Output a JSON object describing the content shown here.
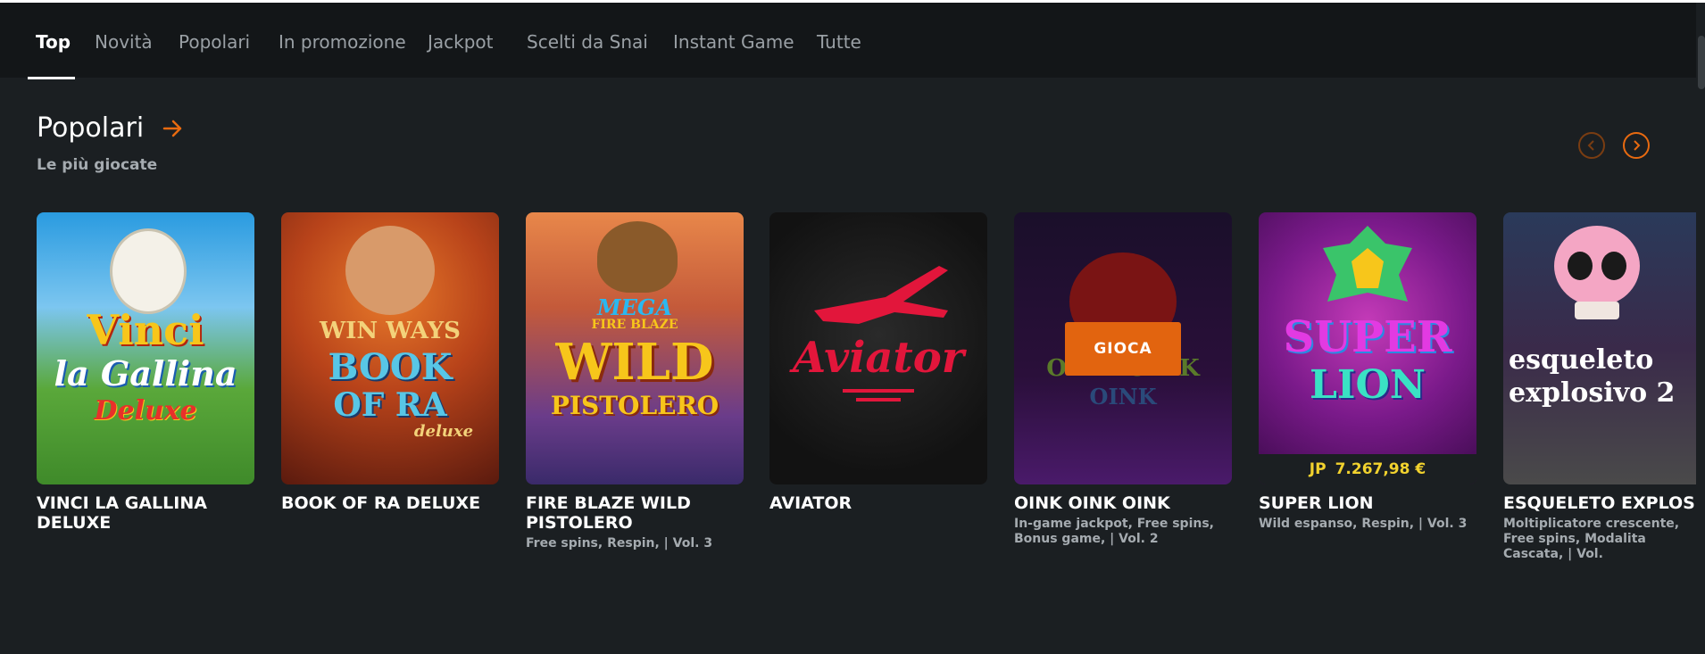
{
  "tabs": [
    {
      "label": "Top",
      "active": true
    },
    {
      "label": "Novità",
      "active": false
    },
    {
      "label": "Popolari",
      "active": false
    },
    {
      "label": "In promozione",
      "active": false
    },
    {
      "label": "Jackpot",
      "active": false
    },
    {
      "label": "Scelti da Snai",
      "active": false
    },
    {
      "label": "Instant Game",
      "active": false
    },
    {
      "label": "Tutte",
      "active": false
    }
  ],
  "section": {
    "title": "Popolari",
    "subtitle": "Le più giocate"
  },
  "colors": {
    "accent": "#e86a10",
    "jackpot": "#f2d22e",
    "background": "#1b1f22"
  },
  "games": [
    {
      "name": "VINCI LA GALLINA DELUXE",
      "desc": "",
      "logo": [
        "Vinci",
        "la Gallina",
        "Deluxe"
      ]
    },
    {
      "name": "BOOK OF RA DELUXE",
      "desc": "",
      "logo": [
        "WIN WAYS",
        "BOOK",
        "OF RA",
        "deluxe"
      ]
    },
    {
      "name": "FIRE BLAZE WILD PISTOLERO",
      "desc": "Free spins, Respin, | Vol. 3",
      "logo": [
        "MEGA",
        "FIRE BLAZE",
        "WILD",
        "PISTOLERO"
      ]
    },
    {
      "name": "AVIATOR",
      "desc": "",
      "logo": [
        "Aviator"
      ]
    },
    {
      "name": "OINK OINK OINK",
      "desc": "In-game jackpot, Free spins, Bonus game, | Vol. 2",
      "play_label": "GIOCA",
      "logo": [
        "OINK OINK",
        "OINK"
      ]
    },
    {
      "name": "SUPER LION",
      "desc": "Wild espanso, Respin, | Vol. 3",
      "jackpot_label": "JP",
      "jackpot_value": "7.267,98 €",
      "logo": [
        "SUPER",
        "LION"
      ]
    },
    {
      "name": "ESQUELETO EXPLOSIVO",
      "desc": "Moltiplicatore crescente, Free spins, Modalita Cascata, | Vol.",
      "logo": [
        "esqueleto",
        "explosivo 2"
      ]
    }
  ]
}
